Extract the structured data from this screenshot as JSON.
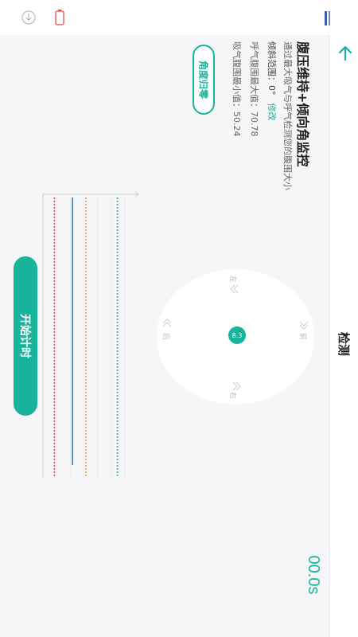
{
  "app": {
    "title": "检测",
    "timer": "00.0s"
  },
  "info": {
    "title": "腹压维持+倾向角监控",
    "description": "通过最大吸气与呼气检测您的腹围大小",
    "tilt_label": "倾斜范围：0°",
    "modify_label": "修改",
    "exhale_label": "呼气腹围最大值：70.78",
    "inhale_label": "吸气腹围最小值：50.24"
  },
  "reset_button": {
    "label": "角度归零"
  },
  "dial": {
    "center_value": "8.3",
    "label_front": "前",
    "label_back": "后",
    "label_left": "左",
    "label_right": "右"
  },
  "start_button": {
    "label": "开始计时"
  },
  "chart_data": {
    "type": "line",
    "title": "",
    "xlabel": "",
    "ylabel": "",
    "series": [
      {
        "color": "#2b7de9",
        "values": [
          0.31,
          0.31,
          0.31,
          0.31,
          0.31,
          0.31,
          0.31
        ]
      }
    ],
    "threshold_lines": [
      {
        "color": "#e04b4b",
        "position": 0.12
      },
      {
        "color": "#f0a23b",
        "position": 0.45
      },
      {
        "color": "#17b39a",
        "position": 0.78
      }
    ],
    "grid": true
  },
  "colors": {
    "accent": "#17b39a",
    "series": "#2b7de9",
    "red": "#e04b4b",
    "orange": "#f0a23b"
  },
  "icons": {
    "back": "back-arrow-icon",
    "download": "download-icon",
    "battery": "battery-icon",
    "logo": "brand-logo-icon"
  }
}
